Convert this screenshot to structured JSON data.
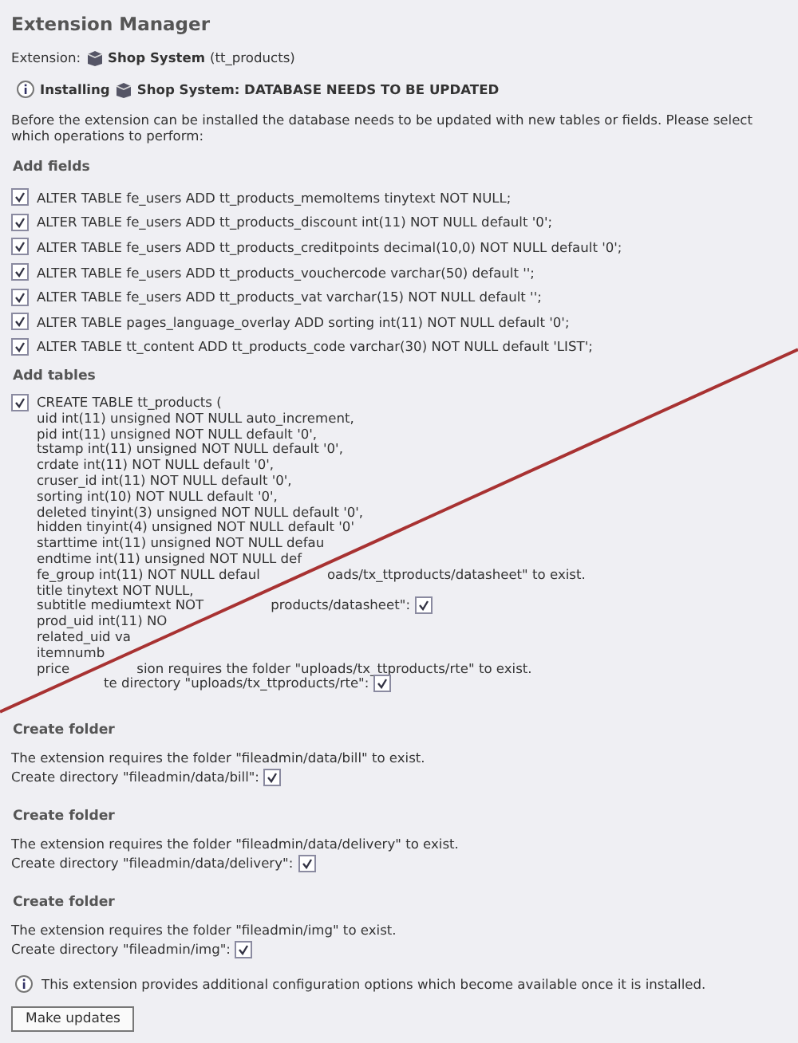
{
  "title": "Extension Manager",
  "extension": {
    "label": "Extension:",
    "name": "Shop System",
    "key": "(tt_products)"
  },
  "notice": {
    "prefix": "Installing",
    "name": "Shop System: DATABASE NEEDS TO BE UPDATED"
  },
  "intro": "Before the extension can be installed the database needs to be updated with new tables or fields. Please select which operations to perform:",
  "add_fields": {
    "heading": "Add fields",
    "items": [
      {
        "text": "ALTER TABLE fe_users ADD tt_products_memoItems tinytext NOT NULL;",
        "checked": true
      },
      {
        "text": "ALTER TABLE fe_users ADD tt_products_discount int(11) NOT NULL default '0';",
        "checked": true
      },
      {
        "text": "ALTER TABLE fe_users ADD tt_products_creditpoints decimal(10,0) NOT NULL default '0';",
        "checked": true
      },
      {
        "text": "ALTER TABLE fe_users ADD tt_products_vouchercode varchar(50) default '';",
        "checked": true
      },
      {
        "text": "ALTER TABLE fe_users ADD tt_products_vat varchar(15) NOT NULL default '';",
        "checked": true
      },
      {
        "text": "ALTER TABLE pages_language_overlay ADD sorting int(11) NOT NULL default '0';",
        "checked": true
      },
      {
        "text": "ALTER TABLE tt_content ADD tt_products_code varchar(30) NOT NULL default 'LIST';",
        "checked": true
      }
    ]
  },
  "add_tables": {
    "heading": "Add tables",
    "checked": true,
    "lines": [
      {
        "parts": [
          "CREATE TABLE tt_products ("
        ]
      },
      {
        "parts": [
          "uid int(11) unsigned NOT NULL auto_increment,"
        ]
      },
      {
        "parts": [
          "pid int(11) unsigned NOT NULL default '0',"
        ]
      },
      {
        "parts": [
          "tstamp int(11) unsigned NOT NULL default '0',"
        ]
      },
      {
        "parts": [
          "crdate int(11) NOT NULL default '0',"
        ]
      },
      {
        "parts": [
          "cruser_id int(11) NOT NULL default '0',"
        ]
      },
      {
        "parts": [
          "sorting int(10) NOT NULL default '0',"
        ]
      },
      {
        "parts": [
          "deleted tinyint(3) unsigned NOT NULL default '0',"
        ]
      },
      {
        "parts": [
          "hidden tinyint(4) unsigned NOT NULL default '0'"
        ]
      },
      {
        "parts": [
          "starttime int(11) unsigned NOT NULL defau"
        ]
      },
      {
        "parts": [
          "endtime int(11) unsigned NOT NULL def"
        ]
      },
      {
        "parts": [
          "fe_group int(11) NOT NULL defaul",
          "oads/tx_ttproducts/datasheet\" to exist."
        ]
      },
      {
        "parts": [
          "title tinytext NOT NULL,"
        ]
      },
      {
        "parts": [
          "subtitle mediumtext NOT",
          "products/datasheet\":"
        ],
        "checked": true
      },
      {
        "parts": [
          "prod_uid int(11) NO"
        ]
      },
      {
        "parts": [
          "related_uid va"
        ]
      },
      {
        "parts": [
          "itemnumb"
        ]
      },
      {
        "parts": [
          "price",
          "sion requires the folder \"uploads/tx_ttproducts/rte\" to exist."
        ]
      },
      {
        "parts": [
          "te directory \"uploads/tx_ttproducts/rte\":"
        ],
        "checked": true,
        "starts_after_mark": true
      }
    ]
  },
  "folders": [
    {
      "heading": "Create folder",
      "requires": "The extension requires the folder \"fileadmin/data/bill\" to exist.",
      "create": "Create directory \"fileadmin/data/bill\":",
      "checked": true
    },
    {
      "heading": "Create folder",
      "requires": "The extension requires the folder \"fileadmin/data/delivery\" to exist.",
      "create": "Create directory \"fileadmin/data/delivery\":",
      "checked": true
    },
    {
      "heading": "Create folder",
      "requires": "The extension requires the folder \"fileadmin/img\" to exist.",
      "create": "Create directory \"fileadmin/img\":",
      "checked": true
    }
  ],
  "info": "This extension provides additional configuration options which become available once it is installed.",
  "button": "Make updates"
}
